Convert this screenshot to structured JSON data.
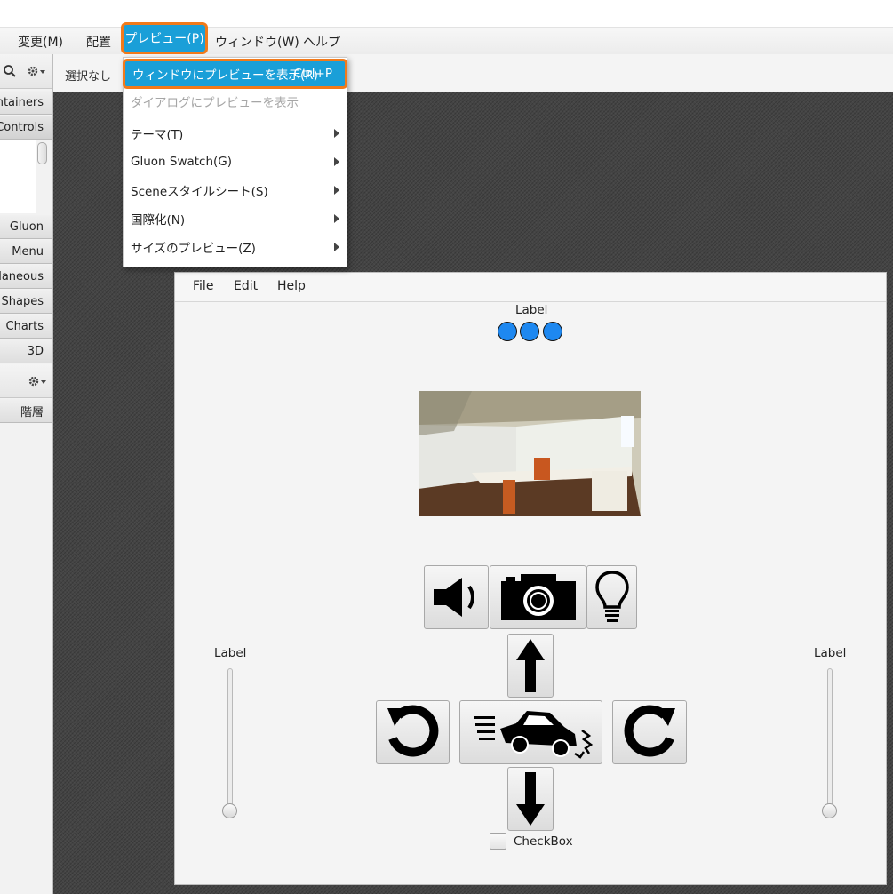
{
  "menubar": {
    "items": [
      "変更(M)",
      "配置",
      "プレビュー(P)",
      "ウィンドウ(W)",
      "ヘルプ"
    ]
  },
  "toolbar": {
    "status": "選択なし"
  },
  "left_panel": {
    "sections": [
      "ontainers",
      "Controls",
      "Gluon",
      "Menu",
      "ellaneous",
      "Shapes",
      "Charts",
      "3D",
      "階層"
    ]
  },
  "dropdown": {
    "items": [
      {
        "label": "ウィンドウにプレビューを表示(R)",
        "shortcut": "Ctrl+P",
        "state": "highlighted"
      },
      {
        "label": "ダイアログにプレビューを表示",
        "state": "disabled"
      },
      {
        "label": "テーマ(T)",
        "submenu": true
      },
      {
        "label": "Gluon Swatch(G)",
        "submenu": true
      },
      {
        "label": "Sceneスタイルシート(S)",
        "submenu": true
      },
      {
        "label": "国際化(N)",
        "submenu": true
      },
      {
        "label": "サイズのプレビュー(Z)",
        "submenu": true
      }
    ]
  },
  "preview": {
    "menus": [
      "File",
      "Edit",
      "Help"
    ],
    "top_label": "Label",
    "left_slider_label": "Label",
    "right_slider_label": "Label",
    "left_slider_value": 0,
    "right_slider_value": 0,
    "checkbox_label": "CheckBox",
    "checkbox_checked": false,
    "indicator_color": "#1e88f0",
    "buttons": [
      "speaker-icon",
      "camera-icon",
      "lightbulb-icon",
      "arrow-up-icon",
      "rotate-left-icon",
      "car-crash-icon",
      "rotate-right-icon",
      "arrow-down-icon"
    ]
  },
  "colors": {
    "accent": "#1a9fd8",
    "highlight_outline": "#f27a1a"
  }
}
